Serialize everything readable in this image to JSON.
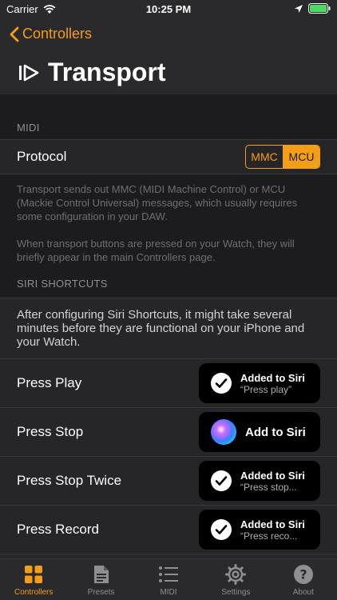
{
  "status": {
    "carrier": "Carrier",
    "time": "10:25 PM"
  },
  "nav": {
    "back_label": "Controllers",
    "title": "Transport"
  },
  "midi": {
    "header": "MIDI",
    "protocol_label": "Protocol",
    "options": [
      "MMC",
      "MCU"
    ],
    "selected": "MCU",
    "footer1": "Transport sends out MMC (MIDI Machine Control) or MCU (Mackie Control Universal) messages, which usually requires some configuration in your DAW.",
    "footer2": "When transport buttons are pressed on your Watch, they will briefly appear in the main Controllers page."
  },
  "siri": {
    "header": "SIRI SHORTCUTS",
    "note": "After configuring Siri Shortcuts, it might take several minutes before they are functional on your iPhone and your Watch.",
    "items": [
      {
        "label": "Press Play",
        "button": "Added to Siri",
        "phrase": "“Press play”"
      },
      {
        "label": "Press Stop",
        "button": "Add to Siri",
        "phrase": ""
      },
      {
        "label": "Press Stop Twice",
        "button": "Added to Siri",
        "phrase": "“Press stop..."
      },
      {
        "label": "Press Record",
        "button": "Added to Siri",
        "phrase": "“Press reco..."
      }
    ]
  },
  "tabs": [
    {
      "label": "Controllers",
      "icon": "grid-icon",
      "active": true
    },
    {
      "label": "Presets",
      "icon": "document-icon",
      "active": false
    },
    {
      "label": "MIDI",
      "icon": "list-icon",
      "active": false
    },
    {
      "label": "Settings",
      "icon": "gear-icon",
      "active": false
    },
    {
      "label": "About",
      "icon": "question-icon",
      "active": false
    }
  ],
  "colors": {
    "accent": "#f49d16",
    "background": "#1c1c1e",
    "cell": "#262628"
  }
}
